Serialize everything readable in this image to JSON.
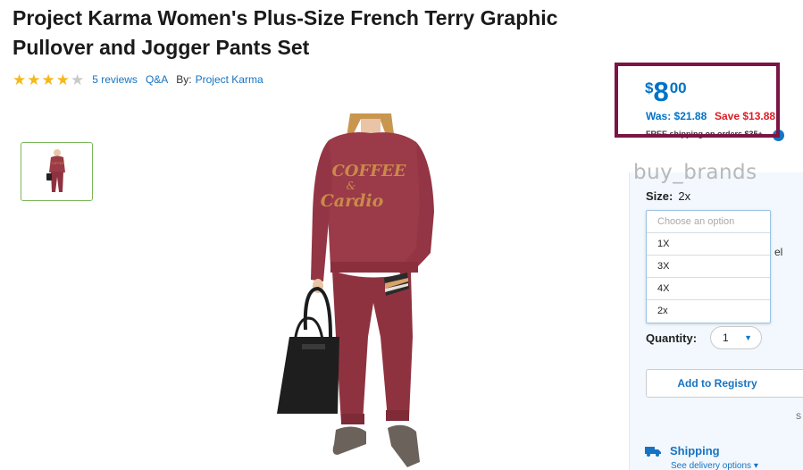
{
  "product": {
    "title": "Project Karma Women's Plus-Size French Terry Graphic Pullover and Jogger Pants Set",
    "rating": 4,
    "rating_max": 5,
    "reviews_label": "5 reviews",
    "qa_label": "Q&A",
    "by_label": "By:",
    "brand": "Project Karma",
    "shirt_text_line1": "COFFEE",
    "shirt_text_line2": "&",
    "shirt_text_line3": "Cardio"
  },
  "price": {
    "currency": "$",
    "dollars": "8",
    "cents": "00",
    "was": "Was: $21.88",
    "save": "Save $13.88",
    "shipping_note": "FREE shipping on orders $35+",
    "info_icon": "info-icon"
  },
  "watermark": "buy_brands",
  "size": {
    "label": "Size:",
    "value": "2x",
    "placeholder": "Choose an option",
    "options": [
      "1X",
      "3X",
      "4X",
      "2x"
    ],
    "hidden_fragment": "el"
  },
  "quantity": {
    "label": "Quantity:",
    "value": "1"
  },
  "registry": {
    "label": "Add to Registry",
    "clipped": "S"
  },
  "shipping": {
    "title": "Shipping",
    "delivery_link": "See delivery options",
    "icon": "truck-icon"
  },
  "colors": {
    "accent_blue": "#0072c6",
    "save_red": "#de1c24",
    "highlight": "#7a1545",
    "star": "#f5b81c",
    "outfit": "#9b3a48"
  }
}
